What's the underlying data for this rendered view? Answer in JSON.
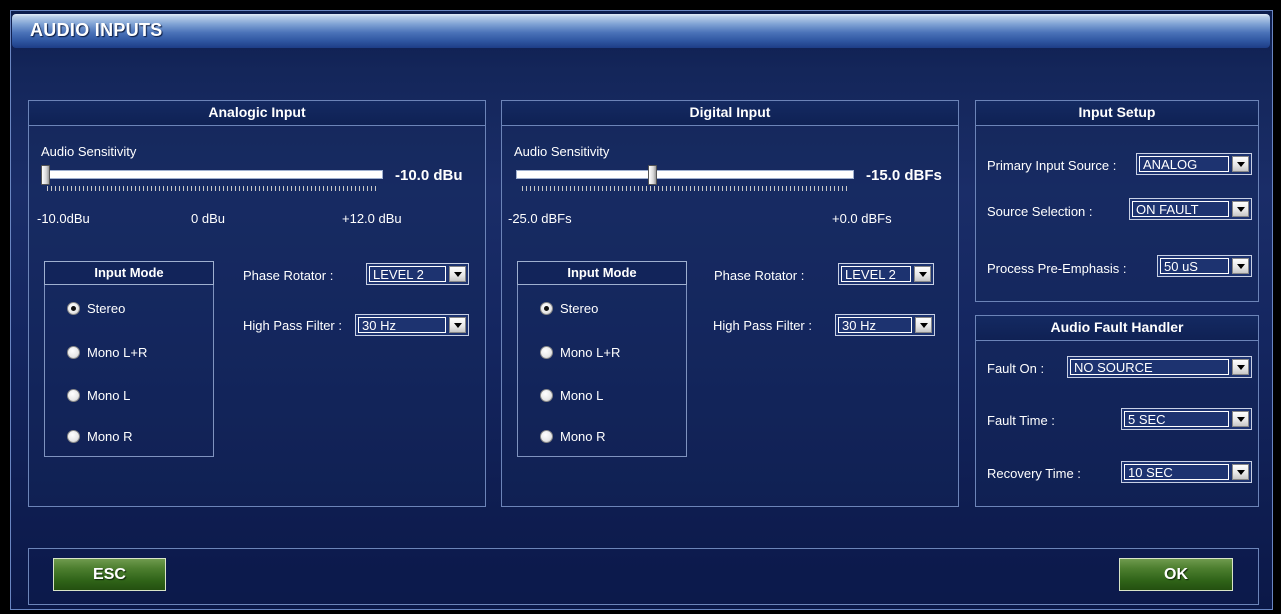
{
  "window": {
    "title": "AUDIO INPUTS"
  },
  "analogic": {
    "header": "Analogic Input",
    "sensitivity_label": "Audio Sensitivity",
    "value": "-10.0 dBu",
    "min_label": "-10.0dBu",
    "mid_label": "0 dBu",
    "max_label": "+12.0 dBu",
    "slider_fraction": 0,
    "input_mode": {
      "title": "Input Mode",
      "options": [
        "Stereo",
        "Mono L+R",
        "Mono L",
        "Mono R"
      ],
      "selected": "Stereo"
    },
    "phase_rotator_label": "Phase Rotator :",
    "phase_rotator_value": "LEVEL 2",
    "hpf_label": "High Pass Filter :",
    "hpf_value": "30 Hz"
  },
  "digital": {
    "header": "Digital Input",
    "sensitivity_label": "Audio Sensitivity",
    "value": "-15.0 dBFs",
    "min_label": "-25.0 dBFs",
    "max_label": "+0.0 dBFs",
    "slider_fraction": 0.4,
    "input_mode": {
      "title": "Input Mode",
      "options": [
        "Stereo",
        "Mono L+R",
        "Mono L",
        "Mono R"
      ],
      "selected": "Stereo"
    },
    "phase_rotator_label": "Phase Rotator :",
    "phase_rotator_value": "LEVEL 2",
    "hpf_label": "High Pass Filter :",
    "hpf_value": "30 Hz"
  },
  "input_setup": {
    "header": "Input Setup",
    "primary_label": "Primary Input Source :",
    "primary_value": "ANALOG",
    "source_label": "Source Selection :",
    "source_value": "ON FAULT",
    "preemph_label": "Process Pre-Emphasis :",
    "preemph_value": "50 uS"
  },
  "fault_handler": {
    "header": "Audio Fault Handler",
    "fault_on_label": "Fault On :",
    "fault_on_value": "NO SOURCE",
    "fault_time_label": "Fault Time :",
    "fault_time_value": "5 SEC",
    "recovery_label": "Recovery Time :",
    "recovery_value": "10 SEC"
  },
  "buttons": {
    "esc": "ESC",
    "ok": "OK"
  },
  "colors": {
    "accent_green": "#2f6318",
    "panel_border": "#6c84b8",
    "background": "#142660"
  }
}
